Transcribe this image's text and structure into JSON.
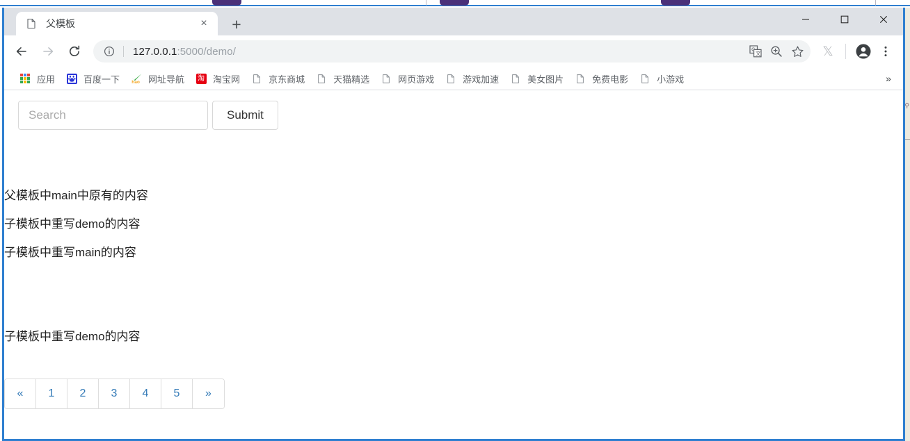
{
  "window": {
    "controls": {
      "minimize": "minimize-button",
      "maximize": "maximize-button",
      "close": "close-button"
    }
  },
  "tabstrip": {
    "tab": {
      "title": "父模板",
      "favicon": "page-icon",
      "close_label": "×"
    },
    "new_tab_label": "+"
  },
  "toolbar": {
    "back_label": "←",
    "forward_label": "→",
    "reload_label": "⟳",
    "url_host": "127.0.0.1",
    "url_path": ":5000/demo/",
    "url_full": "127.0.0.1:5000/demo/",
    "actions": {
      "translate": "translate-icon",
      "zoom": "zoom-icon",
      "bookmark": "star-icon",
      "extension": "𝕏",
      "profile": "profile-avatar",
      "menu": "⋮"
    }
  },
  "bookmarks": {
    "items": [
      {
        "label": "应用",
        "icon": "apps-grid-icon"
      },
      {
        "label": "百度一下",
        "icon": "baidu-icon"
      },
      {
        "label": "网址导航",
        "icon": "hao123-icon"
      },
      {
        "label": "淘宝网",
        "icon": "taobao-icon"
      },
      {
        "label": "京东商城",
        "icon": "page-icon"
      },
      {
        "label": "天猫精选",
        "icon": "page-icon"
      },
      {
        "label": "网页游戏",
        "icon": "page-icon"
      },
      {
        "label": "游戏加速",
        "icon": "page-icon"
      },
      {
        "label": "美女图片",
        "icon": "page-icon"
      },
      {
        "label": "免费电影",
        "icon": "page-icon"
      },
      {
        "label": "小游戏",
        "icon": "page-icon"
      }
    ],
    "overflow_label": "»"
  },
  "page": {
    "search": {
      "placeholder": "Search",
      "value": "",
      "submit_label": "Submit"
    },
    "content_lines": [
      "父模板中main中原有的内容",
      "子模板中重写demo的内容",
      "子模板中重写main的内容"
    ],
    "content_line_bottom": "子模板中重写demo的内容",
    "pagination": {
      "prev_label": "«",
      "pages": [
        "1",
        "2",
        "3",
        "4",
        "5"
      ],
      "next_label": "»"
    }
  },
  "colors": {
    "accent_blue": "#2f7fd0",
    "link_blue": "#337ab7",
    "chrome_bg": "#dee1e6",
    "baidu_blue": "#2a35d8",
    "taobao_red": "#e60012"
  }
}
